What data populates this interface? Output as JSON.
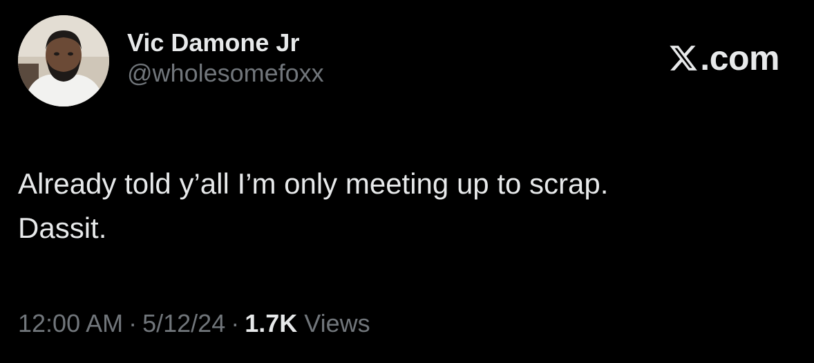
{
  "author": {
    "display_name": "Vic Damone Jr",
    "handle": "@wholesomefoxx",
    "avatar_icon": "profile-photo"
  },
  "brand": {
    "icon": "x-logo-icon",
    "suffix": ".com"
  },
  "tweet": {
    "lines": [
      "Already told y’all I’m only meeting up to scrap.",
      "Dassit."
    ]
  },
  "meta": {
    "time": "12:00 AM",
    "separator": "·",
    "date": "5/12/24",
    "views_count": "1.7K",
    "views_label": "Views"
  },
  "colors": {
    "background": "#000000",
    "primary_text": "#e7e9ea",
    "secondary_text": "#71767b"
  }
}
